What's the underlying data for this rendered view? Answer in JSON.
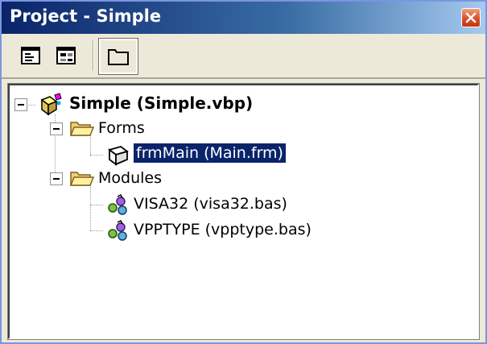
{
  "window": {
    "title": "Project - Simple",
    "accent": "#0a246a"
  },
  "toolbar": {
    "buttons": [
      {
        "name": "view-code",
        "icon": "view-code-icon"
      },
      {
        "name": "view-object",
        "icon": "view-object-icon"
      },
      {
        "name": "toggle-folders",
        "icon": "folder-icon",
        "pressed": true
      }
    ]
  },
  "tree": {
    "root": {
      "label": "Simple (Simple.vbp)",
      "icon": "project-icon",
      "expanded": true
    },
    "forms_folder": {
      "label": "Forms",
      "icon": "folder-open-icon",
      "expanded": true
    },
    "form_item": {
      "label": "frmMain (Main.frm)",
      "icon": "form-icon",
      "selected": true
    },
    "modules_folder": {
      "label": "Modules",
      "icon": "folder-open-icon",
      "expanded": true
    },
    "module_items": [
      {
        "label": "VISA32 (visa32.bas)",
        "icon": "module-icon"
      },
      {
        "label": "VPPTYPE (vpptype.bas)",
        "icon": "module-icon"
      }
    ]
  }
}
